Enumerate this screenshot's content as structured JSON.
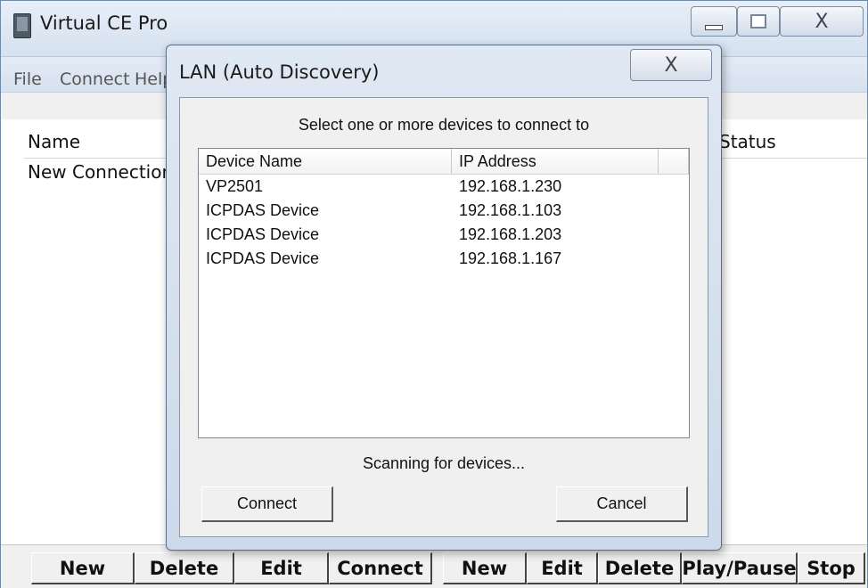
{
  "main_window": {
    "title": "Virtual CE Pro",
    "menu": [
      "File",
      "Connect",
      "Help"
    ],
    "list": {
      "columns": [
        "Name",
        "Status"
      ],
      "rows": [
        "New Connection"
      ]
    },
    "bottom_buttons": [
      "New",
      "Delete",
      "Edit",
      "Connect",
      "New",
      "Edit",
      "Delete",
      "Play/Pause",
      "Stop"
    ]
  },
  "dialog": {
    "title": "LAN (Auto Discovery)",
    "prompt": "Select one or more devices to connect to",
    "columns": [
      "Device Name",
      "IP Address"
    ],
    "devices": [
      {
        "name": "VP2501",
        "ip": "192.168.1.230"
      },
      {
        "name": "ICPDAS Device",
        "ip": "192.168.1.103"
      },
      {
        "name": "ICPDAS Device",
        "ip": "192.168.1.203"
      },
      {
        "name": "ICPDAS Device",
        "ip": "192.168.1.167"
      }
    ],
    "status": "Scanning for devices...",
    "connect_label": "Connect",
    "cancel_label": "Cancel"
  },
  "icons": {
    "close": "X",
    "minimize": "minimize-icon",
    "maximize": "maximize-icon"
  }
}
